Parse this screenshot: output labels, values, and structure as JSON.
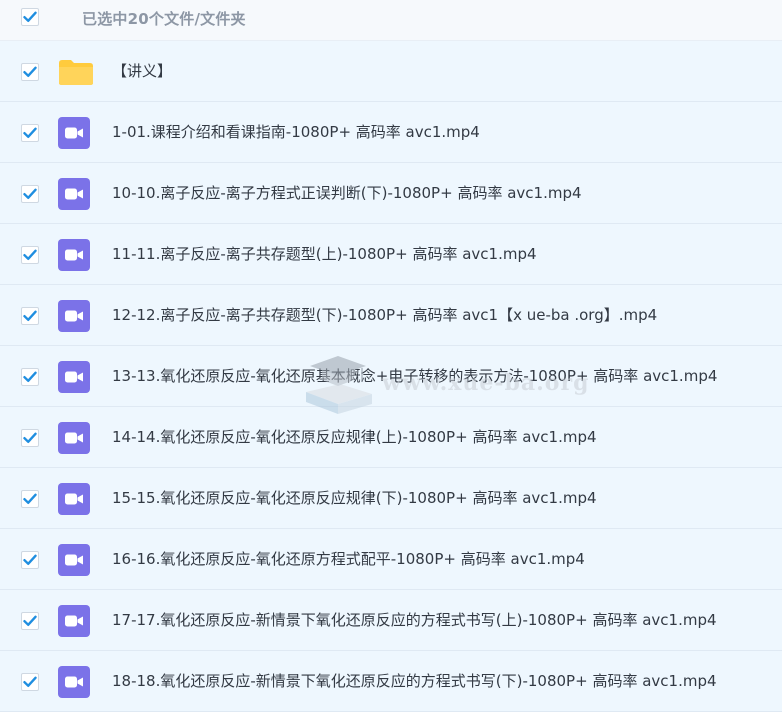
{
  "header": {
    "checked": true,
    "selection_label": "已选中20个文件/文件夹"
  },
  "colors": {
    "row_background": "#eef7fe",
    "check_accent": "#1f8ee0",
    "video_icon": "#7b72e8",
    "folder_icon": "#ffcb3d"
  },
  "files": [
    {
      "type": "folder",
      "icon": "folder-icon",
      "checked": true,
      "name": "【讲义】"
    },
    {
      "type": "video",
      "icon": "video-camera-icon",
      "checked": true,
      "name": "1-01.课程介绍和看课指南-1080P+ 高码率 avc1.mp4"
    },
    {
      "type": "video",
      "icon": "video-camera-icon",
      "checked": true,
      "name": "10-10.离子反应-离子方程式正误判断(下)-1080P+ 高码率 avc1.mp4"
    },
    {
      "type": "video",
      "icon": "video-camera-icon",
      "checked": true,
      "name": "11-11.离子反应-离子共存题型(上)-1080P+ 高码率 avc1.mp4"
    },
    {
      "type": "video",
      "icon": "video-camera-icon",
      "checked": true,
      "name": "12-12.离子反应-离子共存题型(下)-1080P+ 高码率 avc1【x ue-ba .org】.mp4"
    },
    {
      "type": "video",
      "icon": "video-camera-icon",
      "checked": true,
      "name": "13-13.氧化还原反应-氧化还原基本概念+电子转移的表示方法-1080P+ 高码率 avc1.mp4"
    },
    {
      "type": "video",
      "icon": "video-camera-icon",
      "checked": true,
      "name": "14-14.氧化还原反应-氧化还原反应规律(上)-1080P+ 高码率 avc1.mp4"
    },
    {
      "type": "video",
      "icon": "video-camera-icon",
      "checked": true,
      "name": "15-15.氧化还原反应-氧化还原反应规律(下)-1080P+ 高码率 avc1.mp4"
    },
    {
      "type": "video",
      "icon": "video-camera-icon",
      "checked": true,
      "name": "16-16.氧化还原反应-氧化还原方程式配平-1080P+ 高码率 avc1.mp4"
    },
    {
      "type": "video",
      "icon": "video-camera-icon",
      "checked": true,
      "name": "17-17.氧化还原反应-新情景下氧化还原反应的方程式书写(上)-1080P+ 高码率 avc1.mp4"
    },
    {
      "type": "video",
      "icon": "video-camera-icon",
      "checked": true,
      "name": "18-18.氧化还原反应-新情景下氧化还原反应的方程式书写(下)-1080P+ 高码率 avc1.mp4"
    }
  ],
  "watermark": {
    "text": "www.xue-ba.org",
    "icon": "graduation-cap-book-icon"
  }
}
